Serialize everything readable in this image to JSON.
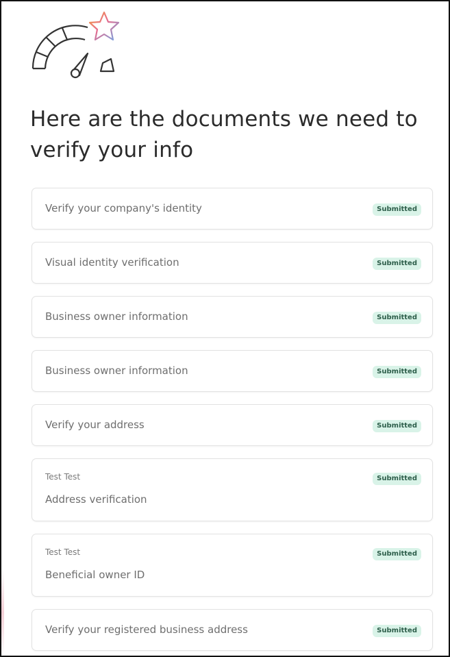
{
  "header": {
    "title": "Here are the documents we need to verify your info",
    "logo_icon": "speedometer-star-icon"
  },
  "colors": {
    "badge_background": "#d9f3e8",
    "badge_text": "#2d5e4a",
    "heading_text": "#2b2b2b",
    "card_text": "#6e6e6e"
  },
  "documents": [
    {
      "title": "Verify your company's identity",
      "owner": "",
      "status": "Submitted"
    },
    {
      "title": "Visual identity verification",
      "owner": "",
      "status": "Submitted"
    },
    {
      "title": "Business owner information",
      "owner": "",
      "status": "Submitted"
    },
    {
      "title": "Business owner information",
      "owner": "",
      "status": "Submitted"
    },
    {
      "title": "Verify your address",
      "owner": "",
      "status": "Submitted"
    },
    {
      "title": "Address verification",
      "owner": "Test Test",
      "status": "Submitted"
    },
    {
      "title": "Beneficial owner ID",
      "owner": "Test Test",
      "status": "Submitted"
    },
    {
      "title": "Verify your registered business address",
      "owner": "",
      "status": "Submitted"
    }
  ]
}
